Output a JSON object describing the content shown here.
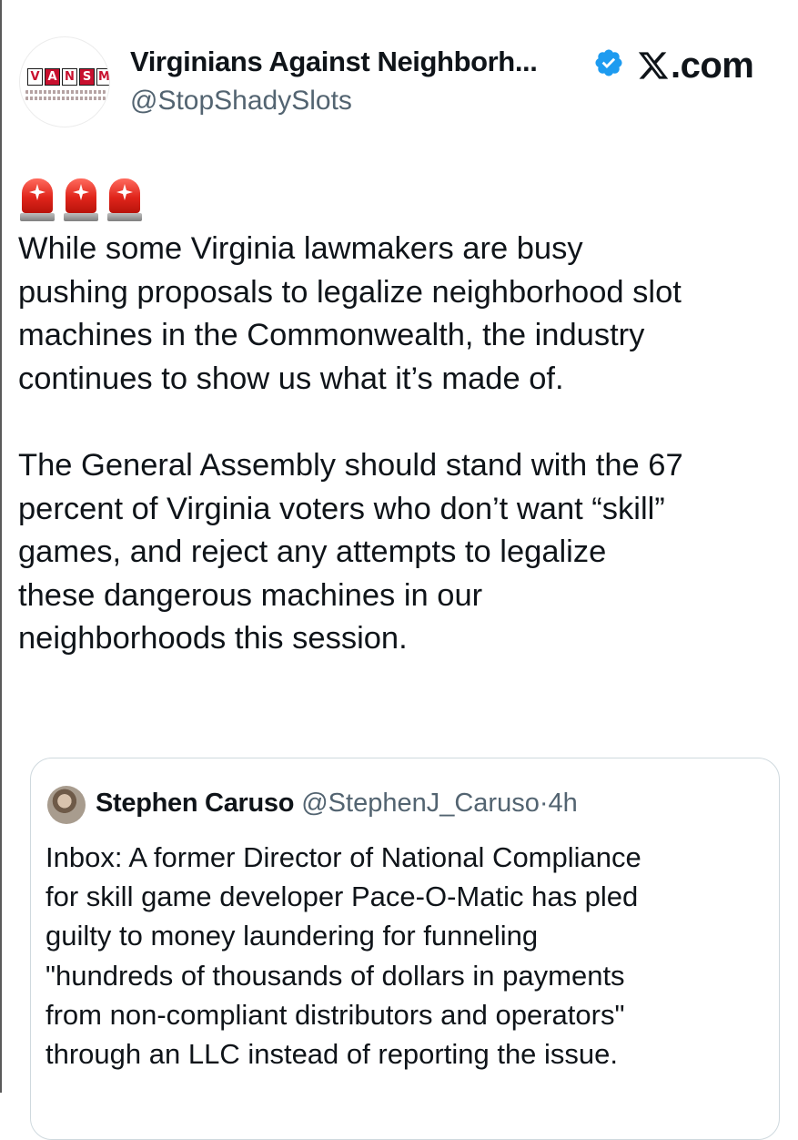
{
  "post": {
    "author": {
      "display_name": "Virginians Against Neighborh...",
      "handle": "@StopShadySlots",
      "verified": true,
      "avatar_logo_letters": [
        "V",
        "A",
        "N",
        "S",
        "M"
      ]
    },
    "site_label": ".com",
    "emoji": [
      "police-car-light",
      "police-car-light",
      "police-car-light"
    ],
    "text": "While some Virginia lawmakers are busy\npushing proposals to legalize neighborhood slot\nmachines in the Commonwealth, the industry\ncontinues to show us what it’s made of.\n\nThe General Assembly should stand with the 67\npercent of Virginia voters who don’t want “skill”\ngames, and reject any attempts to legalize\nthese dangerous machines in our\nneighborhoods this session."
  },
  "quoted": {
    "display_name": "Stephen Caruso",
    "handle": "@StephenJ_Caruso",
    "separator": "·",
    "time": "4h",
    "text": "Inbox: A former Director of National Compliance\nfor skill game developer Pace-O-Matic has pled\nguilty to money laundering for funneling\n\"hundreds of thousands of dollars in payments\nfrom non-compliant distributors and operators\"\nthrough an LLC instead of reporting the issue."
  },
  "colors": {
    "text": "#0f1419",
    "secondary": "#536471",
    "verified": "#1d9bf0",
    "border": "#cfd9de",
    "logo_red": "#c8102e"
  }
}
